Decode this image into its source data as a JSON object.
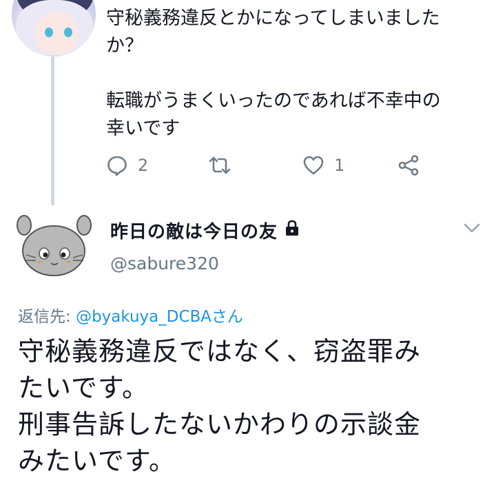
{
  "parent_tweet": {
    "text_lines": [
      "守秘義務違反とかになってしまいました",
      "か？",
      "",
      "転職がうまくいったのであれば不幸中の",
      "幸いです"
    ],
    "reply_count": "2",
    "like_count": "1",
    "icons": [
      "reply-icon",
      "retweet-icon",
      "like-icon",
      "share-icon"
    ]
  },
  "reply_tweet": {
    "display_name": "昨日の敵は今日の友",
    "handle": "@sabure320",
    "reply_to_label": "返信先: ",
    "reply_to_mention": "@byakuya_DCBAさん",
    "text_lines": [
      "守秘義務違反ではなく、窃盗罪み",
      "たいです。",
      "刑事告訴したないかわりの示談金",
      "みたいです。"
    ]
  },
  "colors": {
    "text": "#141823",
    "muted": "#657786",
    "link": "#1b95e0",
    "thread_line": "#cfd9e0"
  }
}
